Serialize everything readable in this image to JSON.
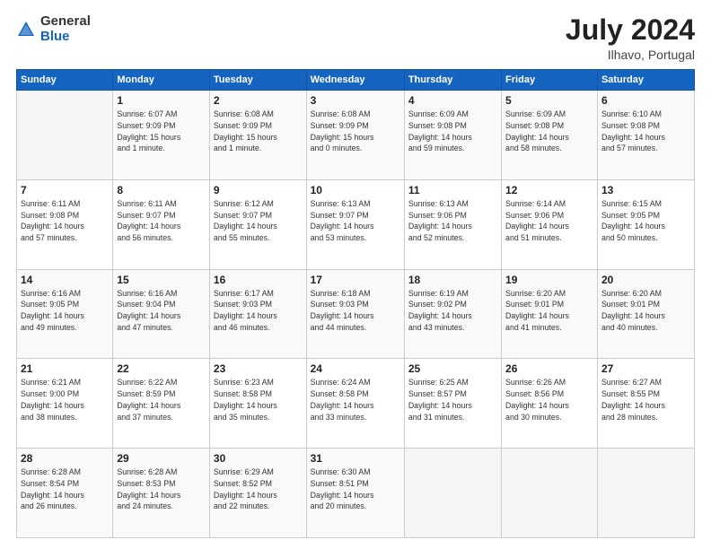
{
  "header": {
    "logo_general": "General",
    "logo_blue": "Blue",
    "title": "July 2024",
    "location": "Ilhavo, Portugal"
  },
  "days_of_week": [
    "Sunday",
    "Monday",
    "Tuesday",
    "Wednesday",
    "Thursday",
    "Friday",
    "Saturday"
  ],
  "weeks": [
    [
      {
        "day": "",
        "info": ""
      },
      {
        "day": "1",
        "info": "Sunrise: 6:07 AM\nSunset: 9:09 PM\nDaylight: 15 hours\nand 1 minute."
      },
      {
        "day": "2",
        "info": "Sunrise: 6:08 AM\nSunset: 9:09 PM\nDaylight: 15 hours\nand 1 minute."
      },
      {
        "day": "3",
        "info": "Sunrise: 6:08 AM\nSunset: 9:09 PM\nDaylight: 15 hours\nand 0 minutes."
      },
      {
        "day": "4",
        "info": "Sunrise: 6:09 AM\nSunset: 9:08 PM\nDaylight: 14 hours\nand 59 minutes."
      },
      {
        "day": "5",
        "info": "Sunrise: 6:09 AM\nSunset: 9:08 PM\nDaylight: 14 hours\nand 58 minutes."
      },
      {
        "day": "6",
        "info": "Sunrise: 6:10 AM\nSunset: 9:08 PM\nDaylight: 14 hours\nand 57 minutes."
      }
    ],
    [
      {
        "day": "7",
        "info": "Sunrise: 6:11 AM\nSunset: 9:08 PM\nDaylight: 14 hours\nand 57 minutes."
      },
      {
        "day": "8",
        "info": "Sunrise: 6:11 AM\nSunset: 9:07 PM\nDaylight: 14 hours\nand 56 minutes."
      },
      {
        "day": "9",
        "info": "Sunrise: 6:12 AM\nSunset: 9:07 PM\nDaylight: 14 hours\nand 55 minutes."
      },
      {
        "day": "10",
        "info": "Sunrise: 6:13 AM\nSunset: 9:07 PM\nDaylight: 14 hours\nand 53 minutes."
      },
      {
        "day": "11",
        "info": "Sunrise: 6:13 AM\nSunset: 9:06 PM\nDaylight: 14 hours\nand 52 minutes."
      },
      {
        "day": "12",
        "info": "Sunrise: 6:14 AM\nSunset: 9:06 PM\nDaylight: 14 hours\nand 51 minutes."
      },
      {
        "day": "13",
        "info": "Sunrise: 6:15 AM\nSunset: 9:05 PM\nDaylight: 14 hours\nand 50 minutes."
      }
    ],
    [
      {
        "day": "14",
        "info": "Sunrise: 6:16 AM\nSunset: 9:05 PM\nDaylight: 14 hours\nand 49 minutes."
      },
      {
        "day": "15",
        "info": "Sunrise: 6:16 AM\nSunset: 9:04 PM\nDaylight: 14 hours\nand 47 minutes."
      },
      {
        "day": "16",
        "info": "Sunrise: 6:17 AM\nSunset: 9:03 PM\nDaylight: 14 hours\nand 46 minutes."
      },
      {
        "day": "17",
        "info": "Sunrise: 6:18 AM\nSunset: 9:03 PM\nDaylight: 14 hours\nand 44 minutes."
      },
      {
        "day": "18",
        "info": "Sunrise: 6:19 AM\nSunset: 9:02 PM\nDaylight: 14 hours\nand 43 minutes."
      },
      {
        "day": "19",
        "info": "Sunrise: 6:20 AM\nSunset: 9:01 PM\nDaylight: 14 hours\nand 41 minutes."
      },
      {
        "day": "20",
        "info": "Sunrise: 6:20 AM\nSunset: 9:01 PM\nDaylight: 14 hours\nand 40 minutes."
      }
    ],
    [
      {
        "day": "21",
        "info": "Sunrise: 6:21 AM\nSunset: 9:00 PM\nDaylight: 14 hours\nand 38 minutes."
      },
      {
        "day": "22",
        "info": "Sunrise: 6:22 AM\nSunset: 8:59 PM\nDaylight: 14 hours\nand 37 minutes."
      },
      {
        "day": "23",
        "info": "Sunrise: 6:23 AM\nSunset: 8:58 PM\nDaylight: 14 hours\nand 35 minutes."
      },
      {
        "day": "24",
        "info": "Sunrise: 6:24 AM\nSunset: 8:58 PM\nDaylight: 14 hours\nand 33 minutes."
      },
      {
        "day": "25",
        "info": "Sunrise: 6:25 AM\nSunset: 8:57 PM\nDaylight: 14 hours\nand 31 minutes."
      },
      {
        "day": "26",
        "info": "Sunrise: 6:26 AM\nSunset: 8:56 PM\nDaylight: 14 hours\nand 30 minutes."
      },
      {
        "day": "27",
        "info": "Sunrise: 6:27 AM\nSunset: 8:55 PM\nDaylight: 14 hours\nand 28 minutes."
      }
    ],
    [
      {
        "day": "28",
        "info": "Sunrise: 6:28 AM\nSunset: 8:54 PM\nDaylight: 14 hours\nand 26 minutes."
      },
      {
        "day": "29",
        "info": "Sunrise: 6:28 AM\nSunset: 8:53 PM\nDaylight: 14 hours\nand 24 minutes."
      },
      {
        "day": "30",
        "info": "Sunrise: 6:29 AM\nSunset: 8:52 PM\nDaylight: 14 hours\nand 22 minutes."
      },
      {
        "day": "31",
        "info": "Sunrise: 6:30 AM\nSunset: 8:51 PM\nDaylight: 14 hours\nand 20 minutes."
      },
      {
        "day": "",
        "info": ""
      },
      {
        "day": "",
        "info": ""
      },
      {
        "day": "",
        "info": ""
      }
    ]
  ]
}
